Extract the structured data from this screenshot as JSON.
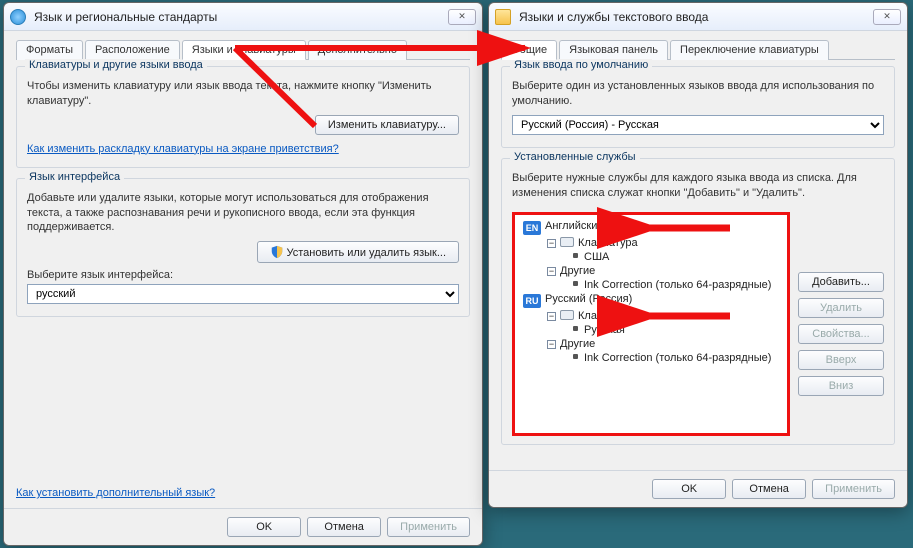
{
  "left": {
    "title": "Язык и региональные стандарты",
    "tabs": [
      "Форматы",
      "Расположение",
      "Языки и клавиатуры",
      "Дополнительно"
    ],
    "active_tab": 2,
    "kb_group": {
      "title": "Клавиатуры и другие языки ввода",
      "desc": "Чтобы изменить клавиатуру или язык ввода текста, нажмите кнопку \"Изменить клавиатуру\".",
      "btn": "Изменить клавиатуру...",
      "link": "Как изменить раскладку клавиатуры на экране приветствия?"
    },
    "ui_group": {
      "title": "Язык интерфейса",
      "desc": "Добавьте или удалите языки, которые могут использоваться для отображения текста, а также распознавания речи и рукописного ввода, если эта функция поддерживается.",
      "btn": "Установить или удалить язык...",
      "select_label": "Выберите язык интерфейса:",
      "select_value": "русский"
    },
    "extra_link": "Как установить дополнительный язык?",
    "ok": "OK",
    "cancel": "Отмена",
    "apply": "Применить"
  },
  "right": {
    "title": "Языки и службы текстового ввода",
    "tabs": [
      "Общие",
      "Языковая панель",
      "Переключение клавиатуры"
    ],
    "active_tab": 0,
    "default_group": {
      "title": "Язык ввода по умолчанию",
      "desc": "Выберите один из установленных языков ввода для использования по умолчанию.",
      "select_value": "Русский (Россия) - Русская"
    },
    "installed_group": {
      "title": "Установленные службы",
      "desc": "Выберите нужные службы для каждого языка ввода из списка. Для изменения списка служат кнопки \"Добавить\" и \"Удалить\"."
    },
    "tree": {
      "en": {
        "badge": "EN",
        "name": "Английский (США)",
        "keyboard_label": "Клавиатура",
        "keyboard_items": [
          "США"
        ],
        "other_label": "Другие",
        "other_items": [
          "Ink Correction (только 64-разрядные)"
        ]
      },
      "ru": {
        "badge": "RU",
        "name": "Русский (Россия)",
        "keyboard_label": "Клавиатура",
        "keyboard_items": [
          "Русская"
        ],
        "other_label": "Другие",
        "other_items": [
          "Ink Correction (только 64-разрядные)"
        ]
      }
    },
    "side": {
      "add": "Добавить...",
      "remove": "Удалить",
      "props": "Свойства...",
      "up": "Вверх",
      "down": "Вниз"
    },
    "ok": "OK",
    "cancel": "Отмена",
    "apply": "Применить"
  }
}
